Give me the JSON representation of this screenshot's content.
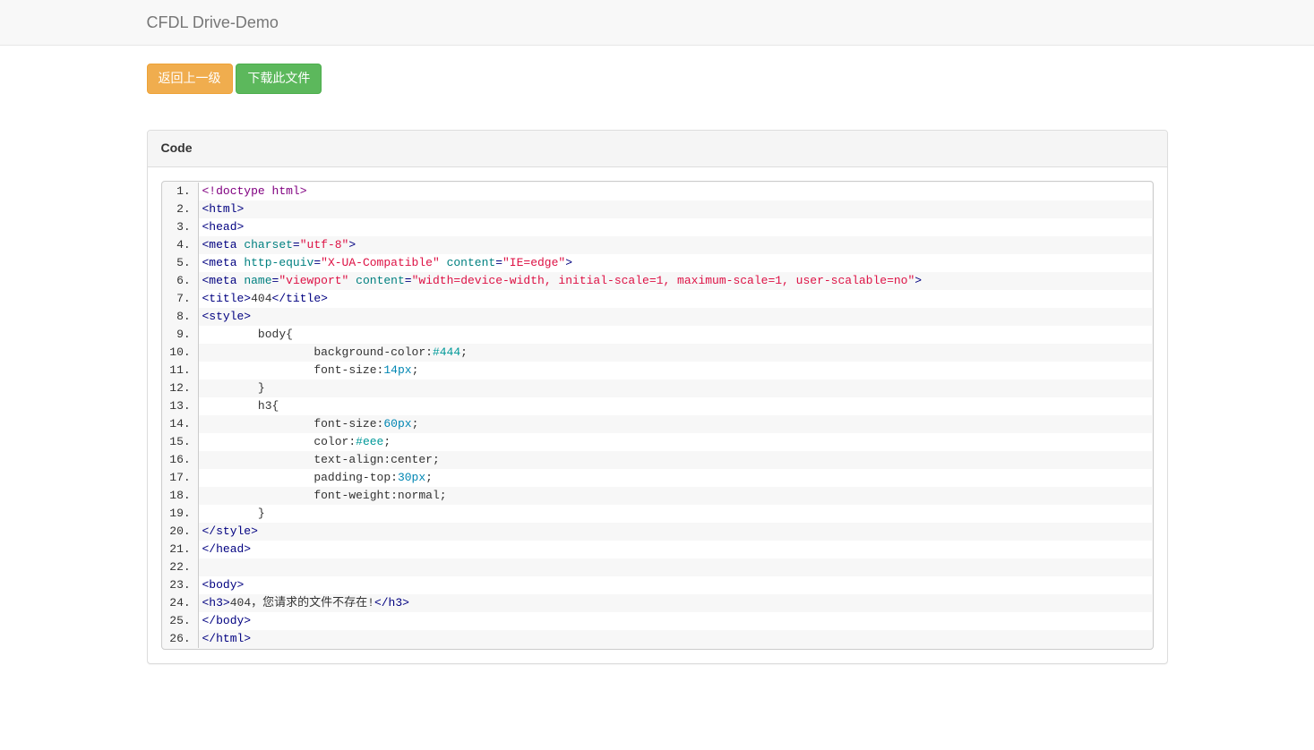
{
  "navbar": {
    "brand": "CFDL Drive-Demo"
  },
  "buttons": {
    "back": "返回上一级",
    "download": "下载此文件"
  },
  "panel": {
    "title": "Code"
  },
  "code": {
    "lines": [
      [
        {
          "cls": "tok-doctype",
          "t": "<!doctype html>"
        }
      ],
      [
        {
          "cls": "tok-tag",
          "t": "<html>"
        }
      ],
      [
        {
          "cls": "tok-tag",
          "t": "<head>"
        }
      ],
      [
        {
          "cls": "tok-tag",
          "t": "<meta "
        },
        {
          "cls": "tok-attr",
          "t": "charset"
        },
        {
          "cls": "tok-tag",
          "t": "="
        },
        {
          "cls": "tok-str",
          "t": "\"utf-8\""
        },
        {
          "cls": "tok-tag",
          "t": ">"
        }
      ],
      [
        {
          "cls": "tok-tag",
          "t": "<meta "
        },
        {
          "cls": "tok-attr",
          "t": "http-equiv"
        },
        {
          "cls": "tok-tag",
          "t": "="
        },
        {
          "cls": "tok-str",
          "t": "\"X-UA-Compatible\""
        },
        {
          "cls": "tok-tag",
          "t": " "
        },
        {
          "cls": "tok-attr",
          "t": "content"
        },
        {
          "cls": "tok-tag",
          "t": "="
        },
        {
          "cls": "tok-str",
          "t": "\"IE=edge\""
        },
        {
          "cls": "tok-tag",
          "t": ">"
        }
      ],
      [
        {
          "cls": "tok-tag",
          "t": "<meta "
        },
        {
          "cls": "tok-attr",
          "t": "name"
        },
        {
          "cls": "tok-tag",
          "t": "="
        },
        {
          "cls": "tok-str",
          "t": "\"viewport\""
        },
        {
          "cls": "tok-tag",
          "t": " "
        },
        {
          "cls": "tok-attr",
          "t": "content"
        },
        {
          "cls": "tok-tag",
          "t": "="
        },
        {
          "cls": "tok-str",
          "t": "\"width=device-width, initial-scale=1, maximum-scale=1, user-scalable=no\""
        },
        {
          "cls": "tok-tag",
          "t": ">"
        }
      ],
      [
        {
          "cls": "tok-tag",
          "t": "<title>"
        },
        {
          "cls": "tok-plain",
          "t": "404"
        },
        {
          "cls": "tok-tag",
          "t": "</title>"
        }
      ],
      [
        {
          "cls": "tok-tag",
          "t": "<style>"
        }
      ],
      [
        {
          "cls": "tok-plain",
          "t": "        body{"
        }
      ],
      [
        {
          "cls": "tok-plain",
          "t": "                background-color:"
        },
        {
          "cls": "tok-color",
          "t": "#444"
        },
        {
          "cls": "tok-plain",
          "t": ";"
        }
      ],
      [
        {
          "cls": "tok-plain",
          "t": "                font-size:"
        },
        {
          "cls": "tok-num",
          "t": "14px"
        },
        {
          "cls": "tok-plain",
          "t": ";"
        }
      ],
      [
        {
          "cls": "tok-plain",
          "t": "        }"
        }
      ],
      [
        {
          "cls": "tok-plain",
          "t": "        h3{"
        }
      ],
      [
        {
          "cls": "tok-plain",
          "t": "                font-size:"
        },
        {
          "cls": "tok-num",
          "t": "60px"
        },
        {
          "cls": "tok-plain",
          "t": ";"
        }
      ],
      [
        {
          "cls": "tok-plain",
          "t": "                color:"
        },
        {
          "cls": "tok-color",
          "t": "#eee"
        },
        {
          "cls": "tok-plain",
          "t": ";"
        }
      ],
      [
        {
          "cls": "tok-plain",
          "t": "                text-align:center;"
        }
      ],
      [
        {
          "cls": "tok-plain",
          "t": "                padding-top:"
        },
        {
          "cls": "tok-num",
          "t": "30px"
        },
        {
          "cls": "tok-plain",
          "t": ";"
        }
      ],
      [
        {
          "cls": "tok-plain",
          "t": "                font-weight:normal;"
        }
      ],
      [
        {
          "cls": "tok-plain",
          "t": "        }"
        }
      ],
      [
        {
          "cls": "tok-tag",
          "t": "</style>"
        }
      ],
      [
        {
          "cls": "tok-tag",
          "t": "</head>"
        }
      ],
      [
        {
          "cls": "tok-plain",
          "t": ""
        }
      ],
      [
        {
          "cls": "tok-tag",
          "t": "<body>"
        }
      ],
      [
        {
          "cls": "tok-tag",
          "t": "<h3>"
        },
        {
          "cls": "tok-plain",
          "t": "404，您请求的文件不存在!"
        },
        {
          "cls": "tok-tag",
          "t": "</h3>"
        }
      ],
      [
        {
          "cls": "tok-tag",
          "t": "</body>"
        }
      ],
      [
        {
          "cls": "tok-tag",
          "t": "</html>"
        }
      ]
    ]
  }
}
